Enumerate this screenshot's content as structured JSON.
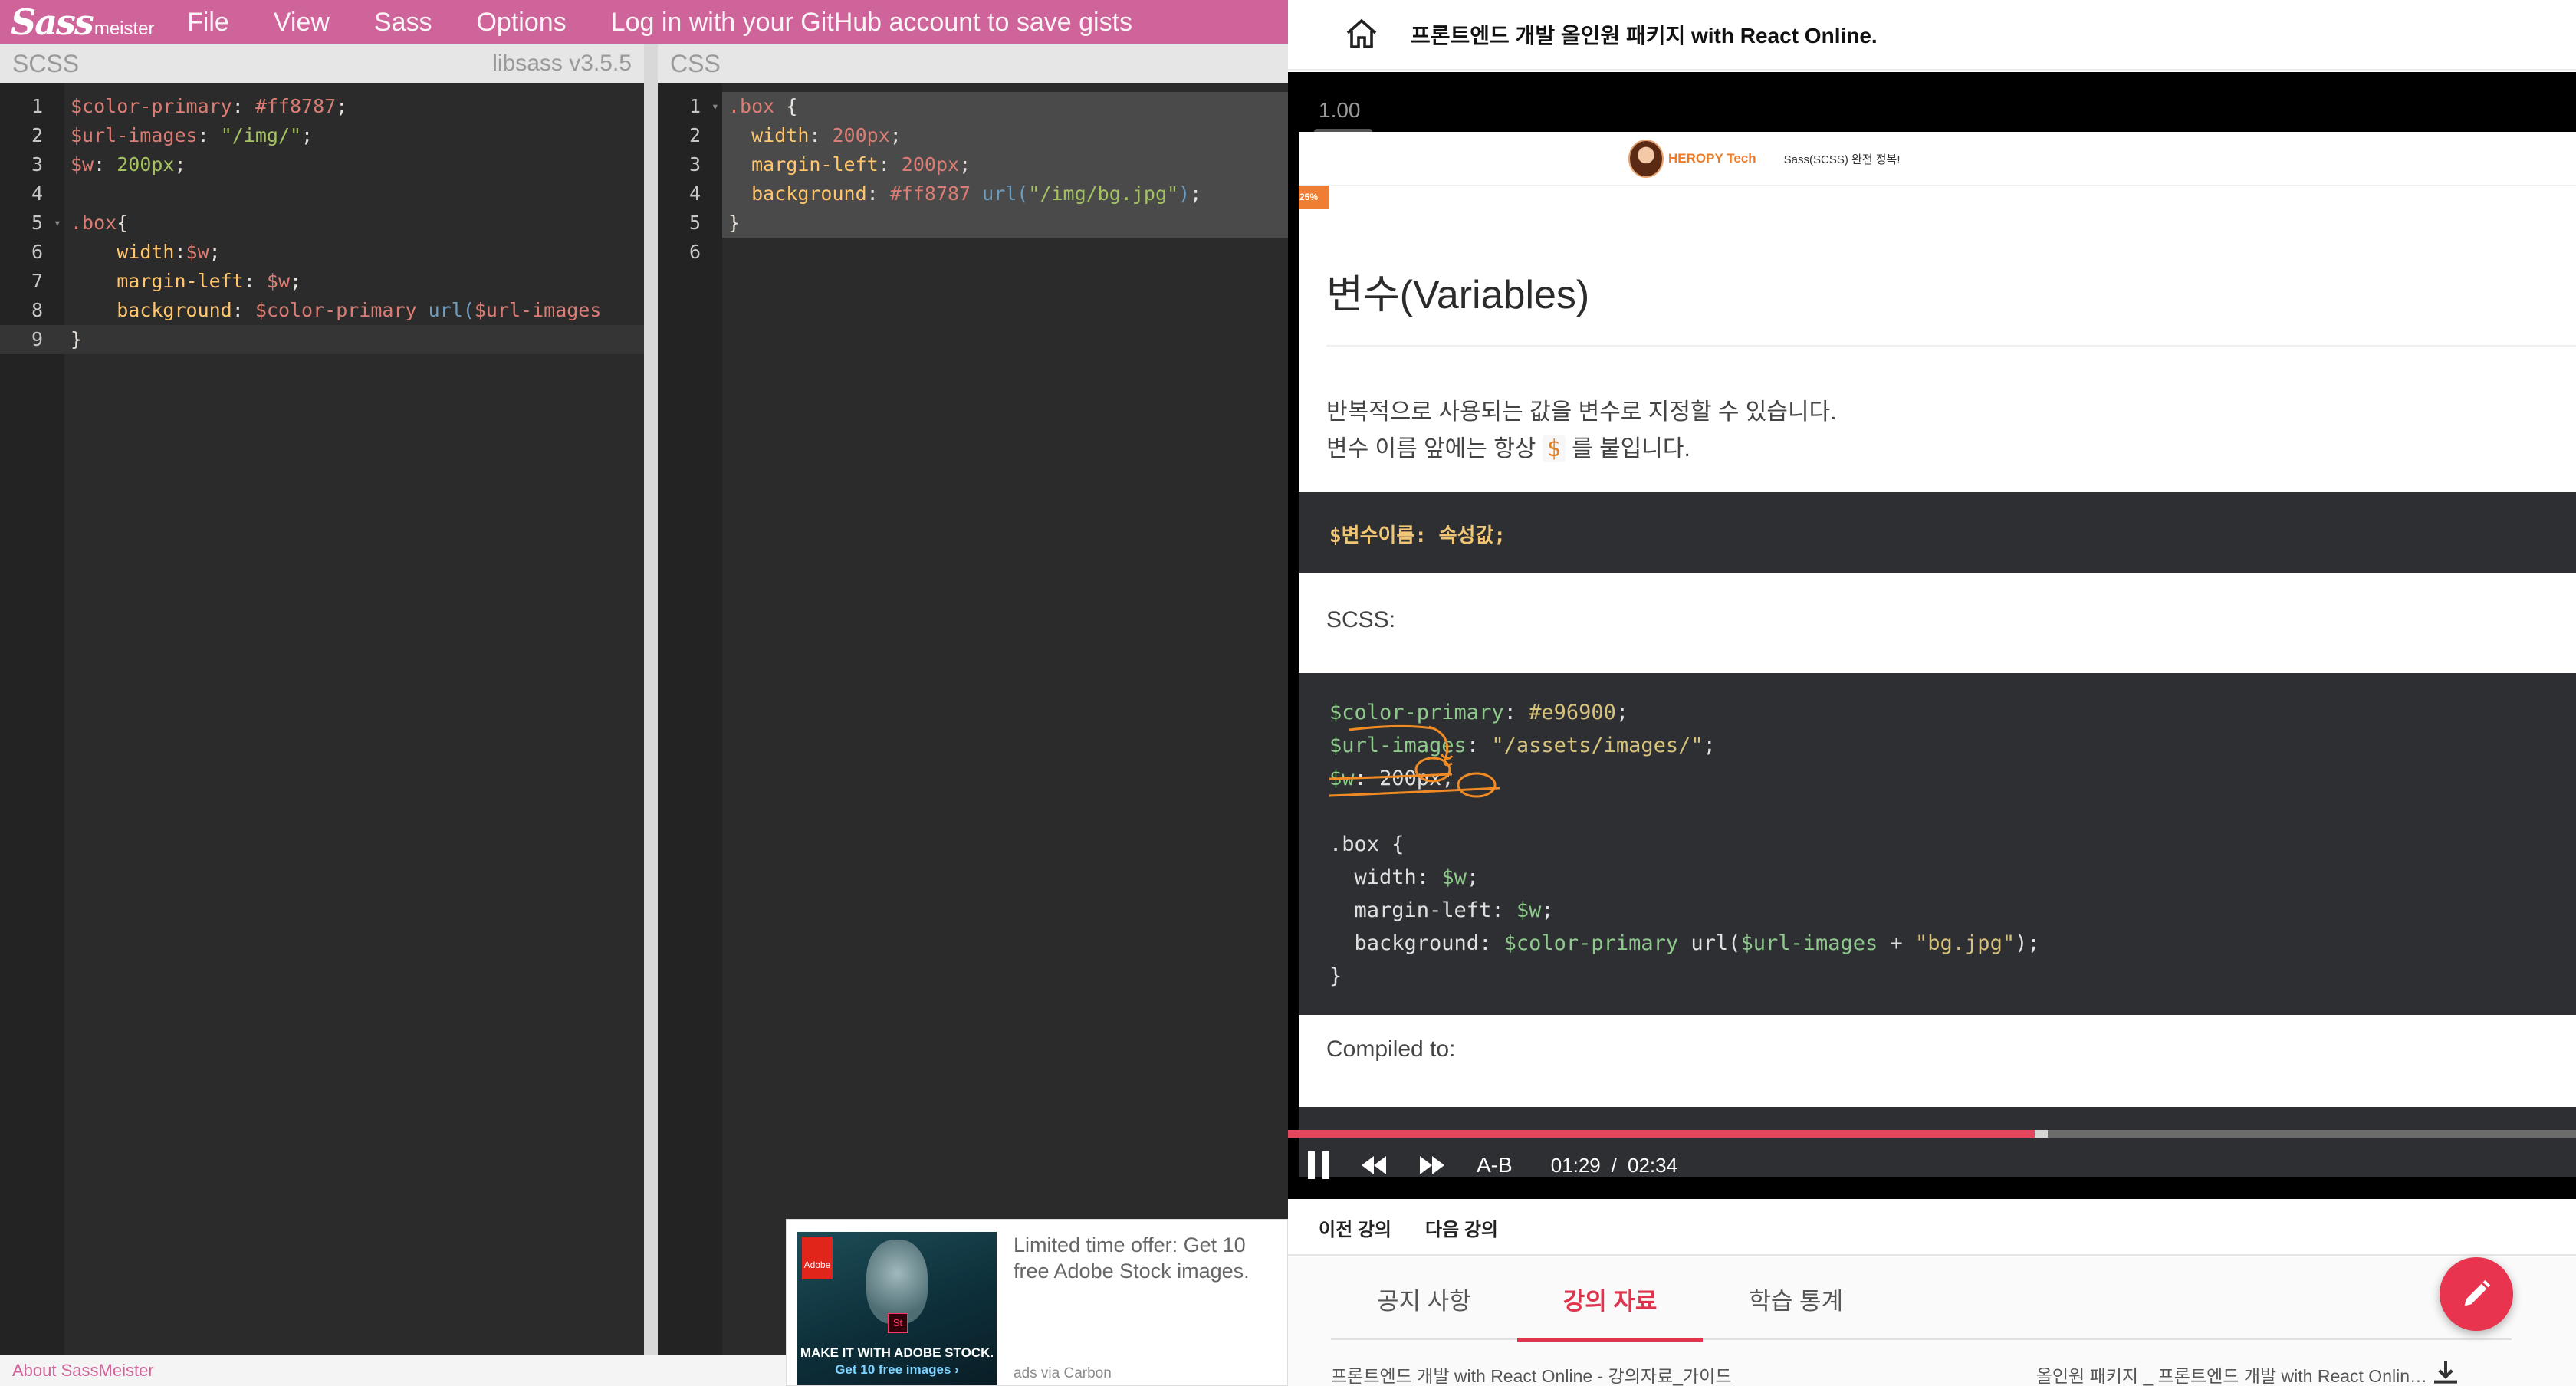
{
  "sassmeister": {
    "logo_sass": "Sass",
    "logo_meister": "meister",
    "menu": [
      "File",
      "View",
      "Sass",
      "Options",
      "Log in with your GitHub account to save gists"
    ],
    "scss_pane": {
      "label": "SCSS",
      "compiler": "libsass v3.5.5"
    },
    "css_pane": {
      "label": "CSS"
    },
    "scss_lines": [
      "1",
      "2",
      "3",
      "4",
      "5",
      "6",
      "7",
      "8",
      "9"
    ],
    "css_lines": [
      "1",
      "2",
      "3",
      "4",
      "5",
      "6"
    ],
    "ad": {
      "text": "Limited time offer: Get 10 free Adobe Stock images.",
      "via": "ads via Carbon",
      "brand": "Adobe",
      "badge": "St",
      "caption1": "MAKE IT WITH ADOBE STOCK.",
      "caption2": "Get 10 free images ›"
    },
    "footer_link": "About SassMeister"
  },
  "lecture": {
    "title": "프론트엔드 개발 올인원 패키지 with React Online.",
    "playback_rate": "1.00",
    "slide": {
      "brand_name": "HEROPY Tech",
      "header_text": "Sass(SCSS) 완전 정복!",
      "progress_badge": "25%",
      "heading": "변수(Variables)",
      "para1": "반복적으로 사용되는 값을 변수로 지정할 수 있습니다.",
      "para2_before": "변수 이름 앞에는 항상 ",
      "para2_symbol": "$",
      "para2_after": " 를 붙입니다.",
      "syntax": "$변수이름: 속성값;",
      "label_scss": "SCSS:",
      "label_compiled": "Compiled to:"
    },
    "player": {
      "ab_label": "A-B",
      "current_time": "01:29",
      "separator": "/",
      "duration": "02:34",
      "progress": 0.58,
      "buffered": 0.59
    },
    "nav": {
      "prev": "이전 강의",
      "next": "다음 강의"
    },
    "tabs": [
      "공지 사항",
      "강의 자료",
      "학습 통계"
    ],
    "active_tab": "강의 자료",
    "materials": {
      "left": "프론트엔드 개발 with React Online - 강의자료_가이드",
      "right": "올인원 패키지 _ 프론트엔드 개발 with React Onlin…"
    }
  }
}
